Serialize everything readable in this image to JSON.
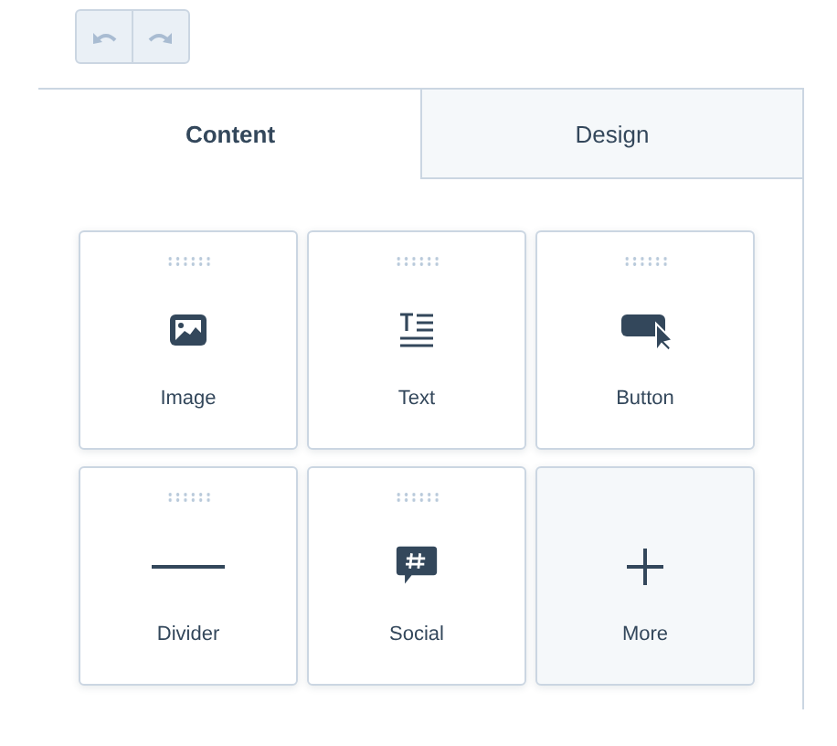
{
  "history": [
    {
      "kind": "undo",
      "disabled": true
    },
    {
      "kind": "redo",
      "disabled": true
    }
  ],
  "tabs": [
    {
      "label": "Content",
      "selected": true
    },
    {
      "label": "Design",
      "selected": false
    }
  ],
  "modules": [
    {
      "kind": "image",
      "label": "Image"
    },
    {
      "kind": "text",
      "label": "Text"
    },
    {
      "kind": "button",
      "label": "Button"
    },
    {
      "kind": "divider",
      "label": "Divider"
    },
    {
      "kind": "social",
      "label": "Social"
    },
    {
      "kind": "more",
      "label": "More"
    }
  ]
}
